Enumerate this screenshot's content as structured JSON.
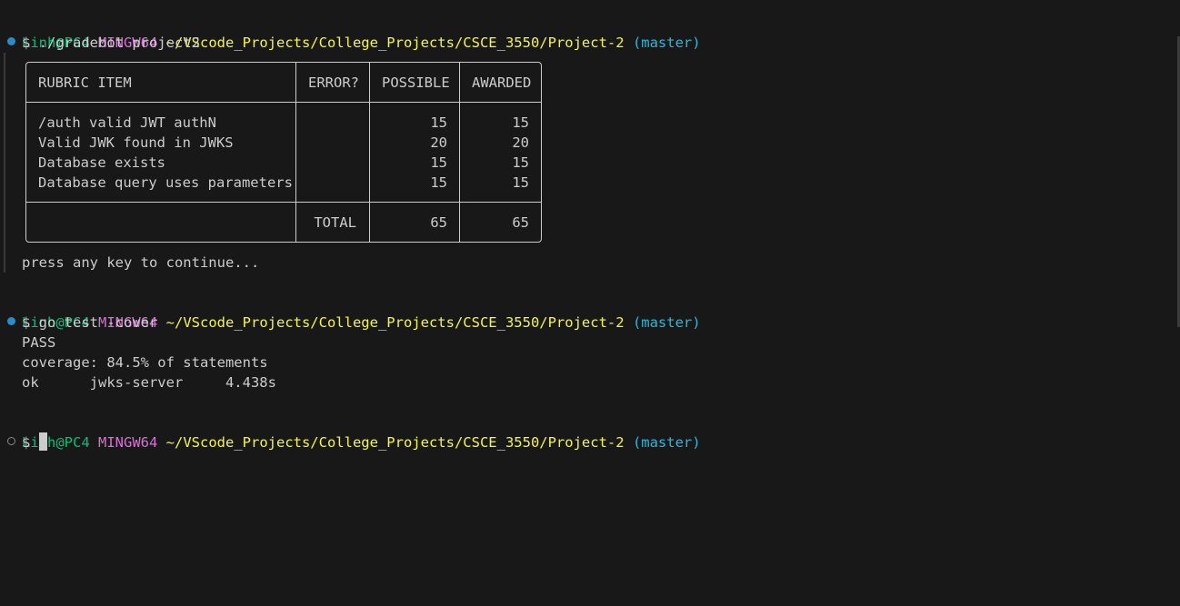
{
  "prompt": {
    "user_host": "Linh@PC4",
    "env": "MINGW64",
    "path": "~/VScode_Projects/College_Projects/CSCE_3550/Project-2",
    "branch": "(master)"
  },
  "commands": {
    "first": "$ ./gradebot project2",
    "second": "$ go test -cover",
    "third_prompt": "$ "
  },
  "rubric": {
    "headers": [
      "RUBRIC ITEM",
      "ERROR?",
      "POSSIBLE",
      "AWARDED"
    ],
    "rows": [
      {
        "item": "/auth valid JWT authN",
        "error": "",
        "possible": "15",
        "awarded": "15"
      },
      {
        "item": "Valid JWK found in JWKS",
        "error": "",
        "possible": "20",
        "awarded": "20"
      },
      {
        "item": "Database exists",
        "error": "",
        "possible": "15",
        "awarded": "15"
      },
      {
        "item": "Database query uses parameters",
        "error": "",
        "possible": "15",
        "awarded": "15"
      }
    ],
    "total_label": "TOTAL",
    "total_possible": "65",
    "total_awarded": "65"
  },
  "outputs": {
    "continue": "press any key to continue...",
    "pass": "PASS",
    "coverage": "coverage: 84.5% of statements",
    "ok_line": "ok      jwks-server     4.438s"
  },
  "colors": {
    "background": "#181818",
    "text": "#cccccc",
    "user": "#0dbc79",
    "env": "#d670d6",
    "path": "#f5f543",
    "branch": "#29b8db",
    "marker_success": "#2b8bc8"
  }
}
